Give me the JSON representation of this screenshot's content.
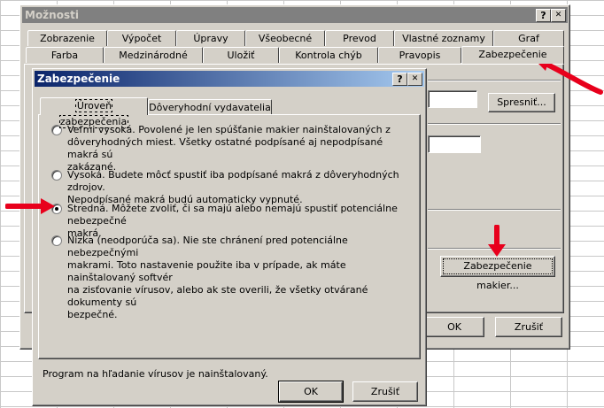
{
  "outer": {
    "title": "Možnosti",
    "help": "?",
    "close": "✕",
    "tabs_row1": [
      "Zobrazenie",
      "Výpočet",
      "Úpravy",
      "Všeobecné",
      "Prevod",
      "Vlastné zoznamy",
      "Graf"
    ],
    "tabs_row2": [
      "Farba",
      "Medzinárodné",
      "Uložiť",
      "Kontrola chýb",
      "Pravopis",
      "Zabezpečenie"
    ],
    "spresnit": "Spresniť...",
    "macro_security": "Zabezpečenie makier...",
    "ok": "OK",
    "cancel": "Zrušiť"
  },
  "inner": {
    "title": "Zabezpečenie",
    "help": "?",
    "close": "✕",
    "tabs": [
      "Úroveň zabezpečenia",
      "Dôveryhodní vydavatelia"
    ],
    "options": [
      {
        "label": "Veľmi vysoká. Povolené je len spúšťanie makier nainštalovaných z",
        "line2": "dôveryhodných miest. Všetky ostatné podpísané aj nepodpísané makrá sú",
        "line3": "zakázané.",
        "checked": false
      },
      {
        "label": "Vysoká. Budete môcť spustiť iba podpísané makrá z dôveryhodných zdrojov.",
        "line2": "Nepodpísané makrá budú automaticky vypnuté.",
        "line3": "",
        "checked": false
      },
      {
        "label": "Stredná. Môžete zvoliť, či sa majú alebo nemajú spustiť potenciálne nebezpečné",
        "line2": "makrá.",
        "line3": "",
        "checked": true
      },
      {
        "label": "Nízka (neodporúča sa). Nie ste chránení pred potenciálne nebezpečnými",
        "line2": "makrami. Toto nastavenie použite iba v prípade, ak máte nainštalovaný softvér",
        "line3": "na zisťovanie vírusov, alebo ak ste overili, že všetky otvárané dokumenty sú",
        "line4": "bezpečné.",
        "checked": false
      }
    ],
    "status": "Program na hľadanie vírusov je nainštalovaný.",
    "ok": "OK",
    "cancel": "Zrušiť"
  },
  "colors": {
    "arrow": "#e8001c",
    "title_active": "#0a246a",
    "face": "#d4d0c8"
  }
}
